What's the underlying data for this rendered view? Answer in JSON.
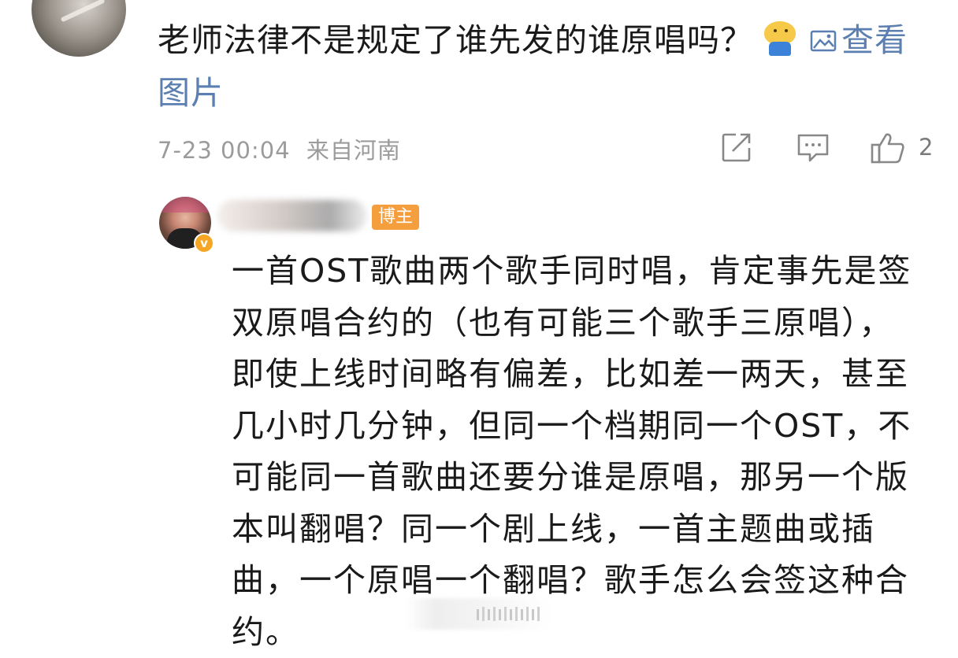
{
  "top_comment": {
    "text": "老师法律不是规定了谁先发的谁原唱吗？",
    "view_image_link": "查看图片",
    "timestamp": "7-23 00:04",
    "location": "来自河南",
    "like_count": "2",
    "icons": [
      "emoji-doge-icon",
      "image-icon",
      "share-icon",
      "comment-icon",
      "like-icon"
    ]
  },
  "reply": {
    "author_badge": "博主",
    "text": "一首OST歌曲两个歌手同时唱，肯定事先是签双原唱合约的（也有可能三个歌手三原唱），即使上线时间略有偏差，比如差一两天，甚至几小时几分钟，但同一个档期同一个OST，不可能同一首歌曲还要分谁是原唱，那另一个版本叫翻唱？同一个剧上线，一首主题曲或插曲，一个原唱一个翻唱？歌手怎么会签这种合约。"
  },
  "colors": {
    "link": "#5b7fb1",
    "meta_gray": "#9b9b9b",
    "author_badge_bg": "#f49e3e",
    "verified_badge": "#f6a623"
  }
}
